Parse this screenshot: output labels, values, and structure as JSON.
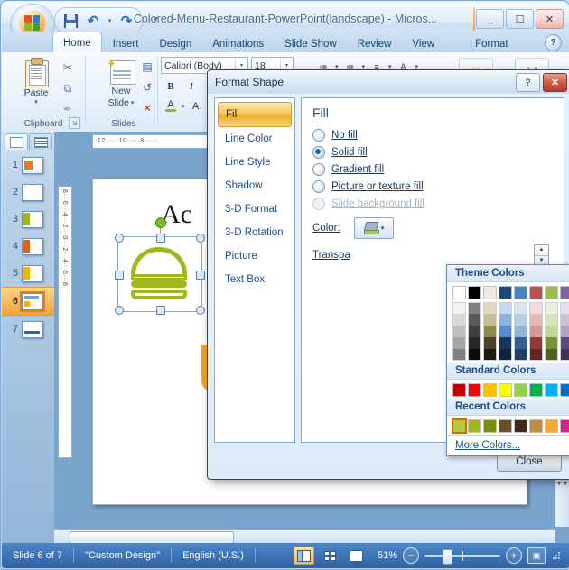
{
  "window": {
    "title": "Colored-Menu-Restaurant-PowerPoint(landscape)  -  Micros...",
    "minimize_label": "_",
    "maximize_label": "☐",
    "close_label": "✕",
    "help_label": "?"
  },
  "quick_access": {
    "save": "save-icon",
    "undo": "↶",
    "redo": "↷",
    "customize": "▾"
  },
  "ribbon": {
    "tabs": [
      {
        "label": "Home",
        "active": true
      },
      {
        "label": "Insert",
        "active": false
      },
      {
        "label": "Design",
        "active": false
      },
      {
        "label": "Animations",
        "active": false
      },
      {
        "label": "Slide Show",
        "active": false
      },
      {
        "label": "Review",
        "active": false
      },
      {
        "label": "View",
        "active": false
      },
      {
        "label": "Format",
        "active": false
      }
    ],
    "groups": {
      "clipboard": {
        "label": "Clipboard",
        "paste": "Paste",
        "paste_arrow": "▾",
        "cut": "✂",
        "copy": "⧉",
        "format_painter": "✒"
      },
      "slides": {
        "label": "Slides",
        "new_slide": "New",
        "new_slide2": "Slide",
        "new_slide_arrow": "▾",
        "layout": "▤",
        "reset": "↺",
        "delete": "✕"
      },
      "font": {
        "font_name": "Calibri (Body)",
        "font_size": "18",
        "bold": "B",
        "italic": "I",
        "font_color": "A",
        "char_spacing": "A"
      },
      "paragraph": {
        "bullets": "≔",
        "numbering": "≔",
        "line_spacing": "≡",
        "text_direction": "A"
      }
    }
  },
  "thumbnail_pane": {
    "tab_slides": "slides-tab-icon",
    "tab_outline": "outline-tab-icon",
    "slides": [
      {
        "number": "1",
        "selected": false
      },
      {
        "number": "2",
        "selected": false
      },
      {
        "number": "3",
        "selected": false
      },
      {
        "number": "4",
        "selected": false
      },
      {
        "number": "5",
        "selected": false
      },
      {
        "number": "6",
        "selected": true
      },
      {
        "number": "7",
        "selected": false
      }
    ]
  },
  "ruler": {
    "horizontal": "·12·····10·····8·····",
    "vertical": "·8···6···4···2···0···2···4···6···8"
  },
  "slide": {
    "title_text": "Ac",
    "shape_hamburger": "hamburger-shape",
    "shape_cup": "coffee-cup-shape",
    "notes_placeholder": ""
  },
  "dialog": {
    "title": "Format Shape",
    "help_label": "?",
    "close_x_label": "✕",
    "nav_items": [
      {
        "label": "Fill",
        "selected": true
      },
      {
        "label": "Line Color",
        "selected": false
      },
      {
        "label": "Line Style",
        "selected": false
      },
      {
        "label": "Shadow",
        "selected": false
      },
      {
        "label": "3-D Format",
        "selected": false
      },
      {
        "label": "3-D Rotation",
        "selected": false
      },
      {
        "label": "Picture",
        "selected": false
      },
      {
        "label": "Text Box",
        "selected": false
      }
    ],
    "pane_heading": "Fill",
    "fill_options": [
      {
        "label": "No fill",
        "underline_at": 0,
        "selected": false,
        "disabled": false
      },
      {
        "label": "Solid fill",
        "underline_at": 0,
        "selected": true,
        "disabled": false
      },
      {
        "label": "Gradient fill",
        "underline_at": 0,
        "selected": false,
        "disabled": false
      },
      {
        "label": "Picture or texture fill",
        "underline_at": 0,
        "selected": false,
        "disabled": false
      },
      {
        "label": "Slide background fill",
        "underline_at": 6,
        "selected": false,
        "disabled": true
      }
    ],
    "color_label": "Color:",
    "transparency_label": "Transpa",
    "close_button": "Close"
  },
  "color_dropdown": {
    "theme_header": "Theme Colors",
    "standard_header": "Standard Colors",
    "recent_header": "Recent Colors",
    "more_colors": "More Colors...",
    "theme_base": [
      "#ffffff",
      "#000000",
      "#eeece1",
      "#1f497d",
      "#4f81bd",
      "#c0504d",
      "#9bbb59",
      "#8064a2",
      "#4bacc6",
      "#f79646"
    ],
    "theme_variants": [
      [
        "#f2f2f2",
        "#d9d9d9",
        "#bfbfbf",
        "#a6a6a6",
        "#808080"
      ],
      [
        "#7f7f7f",
        "#595959",
        "#404040",
        "#262626",
        "#0c0c0c"
      ],
      [
        "#ddd9c3",
        "#c4bd97",
        "#938953",
        "#494429",
        "#1d1b10"
      ],
      [
        "#c6d9f0",
        "#8db3e2",
        "#538dd5",
        "#16365c",
        "#0f243e"
      ],
      [
        "#dbe5f1",
        "#b8cce4",
        "#95b3d7",
        "#366092",
        "#244061"
      ],
      [
        "#f2dcdb",
        "#e5b9b7",
        "#d99694",
        "#953734",
        "#632423"
      ],
      [
        "#ebf1dd",
        "#d7e3bc",
        "#c3d69b",
        "#76923c",
        "#4f6128"
      ],
      [
        "#e5e0ec",
        "#ccc1d9",
        "#b2a2c7",
        "#5f497a",
        "#3f3151"
      ],
      [
        "#dbeef3",
        "#b7dde8",
        "#92cddc",
        "#31859b",
        "#205867"
      ],
      [
        "#fdeada",
        "#fbd5b5",
        "#fac08f",
        "#e36c09",
        "#974806"
      ]
    ],
    "standard_colors": [
      "#c00000",
      "#ff0000",
      "#ffc000",
      "#ffff00",
      "#92d050",
      "#00b050",
      "#00b0f0",
      "#0070c0",
      "#002060",
      "#7030a0"
    ],
    "recent_colors": [
      "#b5c93f",
      "#a2b71c",
      "#7d8c10",
      "#6f4b28",
      "#3e2a1c",
      "#c58a3c",
      "#f0a83a",
      "#d81f8c",
      "#0d9ddb",
      "#f28c28"
    ],
    "recent_selected_index": 0,
    "scroll_up": "▲",
    "scroll_down": "▼"
  },
  "status_bar": {
    "slide_counter": "Slide 6 of 7",
    "theme": "\"Custom Design\"",
    "language": "English (U.S.)",
    "view_normal": "normal-view-icon",
    "view_sorter": "slide-sorter-icon",
    "view_show": "slide-show-icon",
    "zoom_percent": "51%",
    "zoom_out": "−",
    "zoom_in": "+",
    "fit_to_window": "fit-slide-icon"
  }
}
